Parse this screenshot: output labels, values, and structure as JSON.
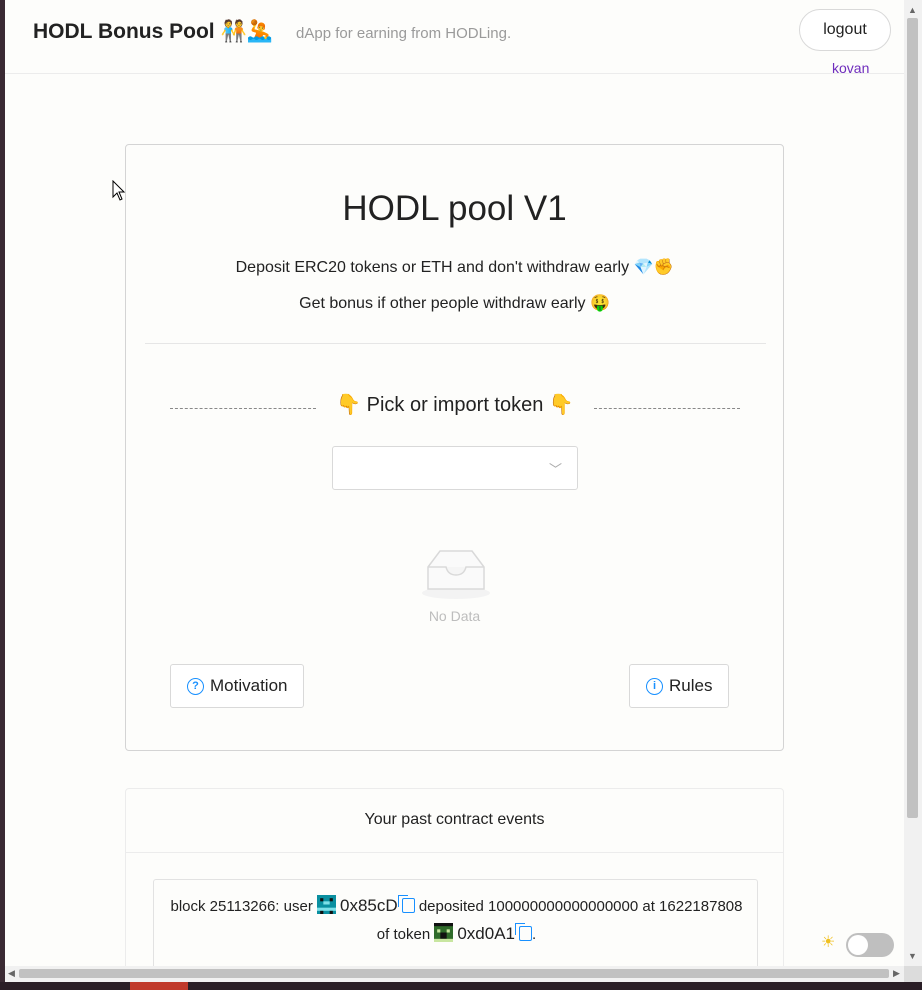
{
  "header": {
    "brand": "HODL Bonus Pool 🧑‍🤝‍🧑🤽",
    "tagline": "dApp for earning from HODLing.",
    "logout_label": "logout",
    "network": "kovan"
  },
  "pool_card": {
    "title": "HODL pool V1",
    "line1": "Deposit ERC20 tokens or ETH and don't withdraw early 💎✊",
    "line2": "Get bonus if other people withdraw early 🤑",
    "pick_label": "👇 Pick or import token 👇",
    "select_value": "",
    "empty_text": "No Data",
    "motivation_label": "Motivation",
    "rules_label": "Rules"
  },
  "events": {
    "title": "Your past contract events",
    "items": [
      {
        "prefix": "block 25113266: user",
        "user": "0x85cD",
        "action": "deposited 100000000000000000 at",
        "timestamp": "1622187808 of token",
        "token": "0xd0A1",
        "suffix": "."
      }
    ]
  },
  "theme": {
    "sun_icon": "☀",
    "dark_mode": false
  },
  "colors": {
    "accent": "#1890ff",
    "network": "#6f2dbd"
  }
}
